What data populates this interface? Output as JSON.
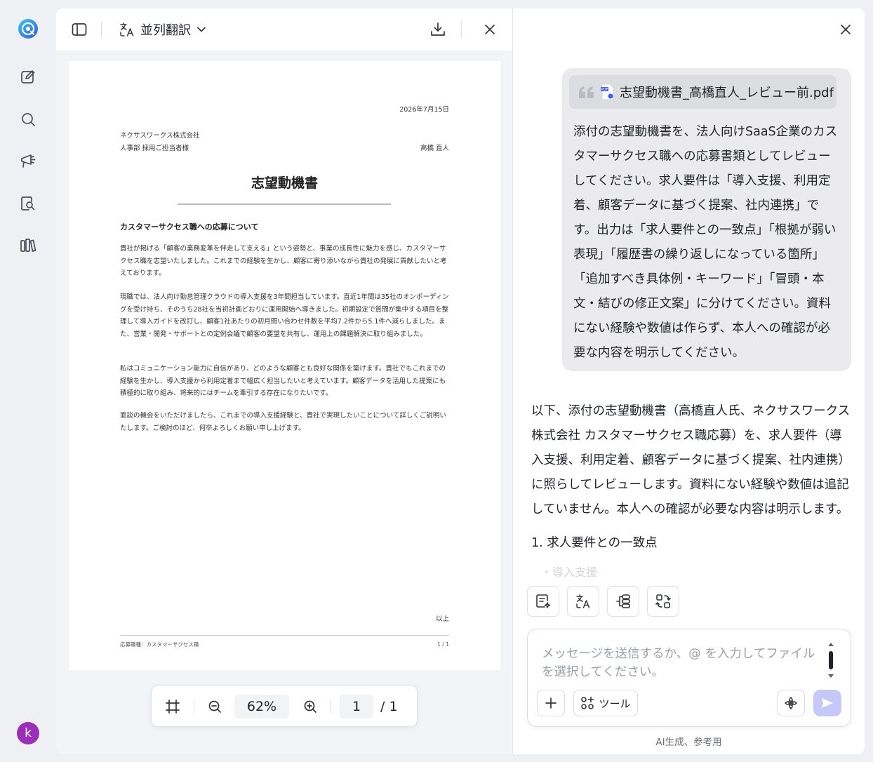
{
  "nav": {
    "items": [
      "logo-icon",
      "new-chat-icon",
      "search-icon",
      "megaphone-icon",
      "doc-search-icon",
      "library-icon"
    ],
    "avatar_letter": "k"
  },
  "viewer": {
    "mode_label": "並列翻訳",
    "zoom": "62%",
    "current_page": "1",
    "total_pages": "/ 1"
  },
  "document": {
    "date": "2026年7月15日",
    "company": "ネクサスワークス株式会社",
    "department": "人事部 採用ご担当者様",
    "author": "高橋 直人",
    "title": "志望動機書",
    "heading": "カスタマーサクセス職への応募について",
    "paragraphs": [
      "貴社が掲げる「顧客の業務変革を伴走して支える」という姿勢と、事業の成長性に魅力を感じ、カスタマーサクセス職を志望いたしました。これまでの経験を生かし、顧客に寄り添いながら貴社の発展に貢献したいと考えております。",
      "現職では、法人向け勤怠管理クラウドの導入支援を3年間担当しています。直近1年間は35社のオンボーディングを受け持ち、そのうち28社を当初計画どおりに運用開始へ導きました。初期設定で質問が集中する項目を整理して導入ガイドを改訂し、顧客1社あたりの初月問い合わせ件数を平均7.2件から5.1件へ減らしました。また、営業・開発・サポートとの定例会議で顧客の要望を共有し、運用上の課題解決に取り組みました。",
      "私はコミュニケーション能力に自信があり、どのような顧客とも良好な関係を築けます。貴社でもこれまでの経験を生かし、導入支援から利用定着まで幅広く担当したいと考えています。顧客データを活用した提案にも積極的に取り組み、将来的にはチームを牽引する存在になりたいです。",
      "面談の機会をいただけましたら、これまでの導入支援経験と、貴社で実現したいことについて詳しくご説明いたします。ご検討のほど、何卒よろしくお願い申し上げます。"
    ],
    "closing": "以上",
    "footer_left": "応募職種：カスタマーサクセス職",
    "footer_right": "1 / 1"
  },
  "chat": {
    "attachment": "志望動機書_高橋直人_レビュー前.pdf",
    "user_message": "添付の志望動機書を、法人向けSaaS企業のカスタマーサクセス職への応募書類としてレビューしてください。求人要件は「導入支援、利用定着、顧客データに基づく提案、社内連携」です。出力は「求人要件との一致点」「根拠が弱い表現」「履歴書の繰り返しになっている箇所」「追加すべき具体例・キーワード」「冒頭・本文・結びの修正文案」に分けてください。資料にない経験や数値は作らず、本人への確認が必要な内容を明示してください。",
    "ai_message": "以下、添付の志望動機書（高橋直人氏、ネクサスワークス株式会社 カスタマーサクセス職応募）を、求人要件（導入支援、利用定着、顧客データに基づく提案、社内連携）に照らしてレビューします。資料にない経験や数値は追記していません。本人への確認が必要な内容は明示します。",
    "ai_heading": "1. 求人要件との一致点",
    "ai_fade": "・導入支援",
    "quick_actions": [
      "summarize-icon",
      "translate-icon",
      "mindmap-icon",
      "convert-icon"
    ],
    "input_placeholder": "メッセージを送信するか、@ を入力してファイルを選択してください。",
    "tool_label": "ツール",
    "disclaimer": "AI生成、参考用"
  },
  "colors": {
    "accent": "#4a5ae8",
    "send_disabled": "#c6c9f7",
    "avatar": "#9b2fb7",
    "bubble": "#ebebed"
  }
}
